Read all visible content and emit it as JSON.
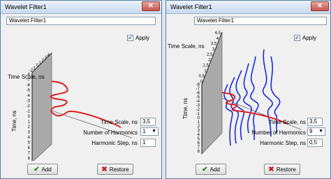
{
  "left": {
    "title": "Wavelet Filter1",
    "name_value": "Wavelet Filter1",
    "apply_label": "Apply",
    "apply_checked": true,
    "axis_top_label": "Time Scale, ns",
    "axis_side_label": "Time, ns",
    "depth_ticks": [
      "4",
      "3",
      "2",
      "1",
      "0",
      "-1",
      "-2"
    ],
    "time_ticks": [
      "-8",
      "-7",
      "-6",
      "-5",
      "-4",
      "-3",
      "-2",
      "-1",
      "0",
      "1",
      "2",
      "3",
      "4",
      "5",
      "6",
      "7",
      "8"
    ],
    "time_scale_label": "Time Scale, ns",
    "time_scale_value": "3,5",
    "harmonics_label": "Number of Harmonics",
    "harmonics_value": "1",
    "harmonic_step_label": "Harmonic Step, ns",
    "harmonic_step_value": "1",
    "add_label": "Add",
    "restore_label": "Restore"
  },
  "right": {
    "title": "Wavelet Filter1",
    "name_value": "Wavelet Filter1",
    "apply_label": "Apply",
    "apply_checked": true,
    "axis_top_label": "Time Scale, ns",
    "axis_side_label": "Time, ns",
    "depth_ticks": [
      "4,5",
      "4",
      "3,5",
      "3",
      "2,5",
      "2",
      "1,5",
      "1",
      "0,5",
      "0"
    ],
    "time_ticks": [
      "-8",
      "-7",
      "-6",
      "-5",
      "-4",
      "-3",
      "-2",
      "-1",
      "0",
      "1",
      "2",
      "3",
      "4",
      "5",
      "6",
      "7",
      "8"
    ],
    "time_scale_label": "Time Scale, ns",
    "time_scale_value": "3,5",
    "harmonics_label": "Number of Harmonics",
    "harmonics_value": "9",
    "harmonic_step_label": "Harmonic Step, ns",
    "harmonic_step_value": "0,5",
    "add_label": "Add",
    "restore_label": "Restore"
  },
  "colors": {
    "main_wave": "#e02020",
    "harmonic_wave": "#1a2ad6",
    "plane": "#a9a9a9"
  },
  "icons": {
    "add": "check-icon",
    "restore": "x-icon",
    "close": "close-icon"
  }
}
